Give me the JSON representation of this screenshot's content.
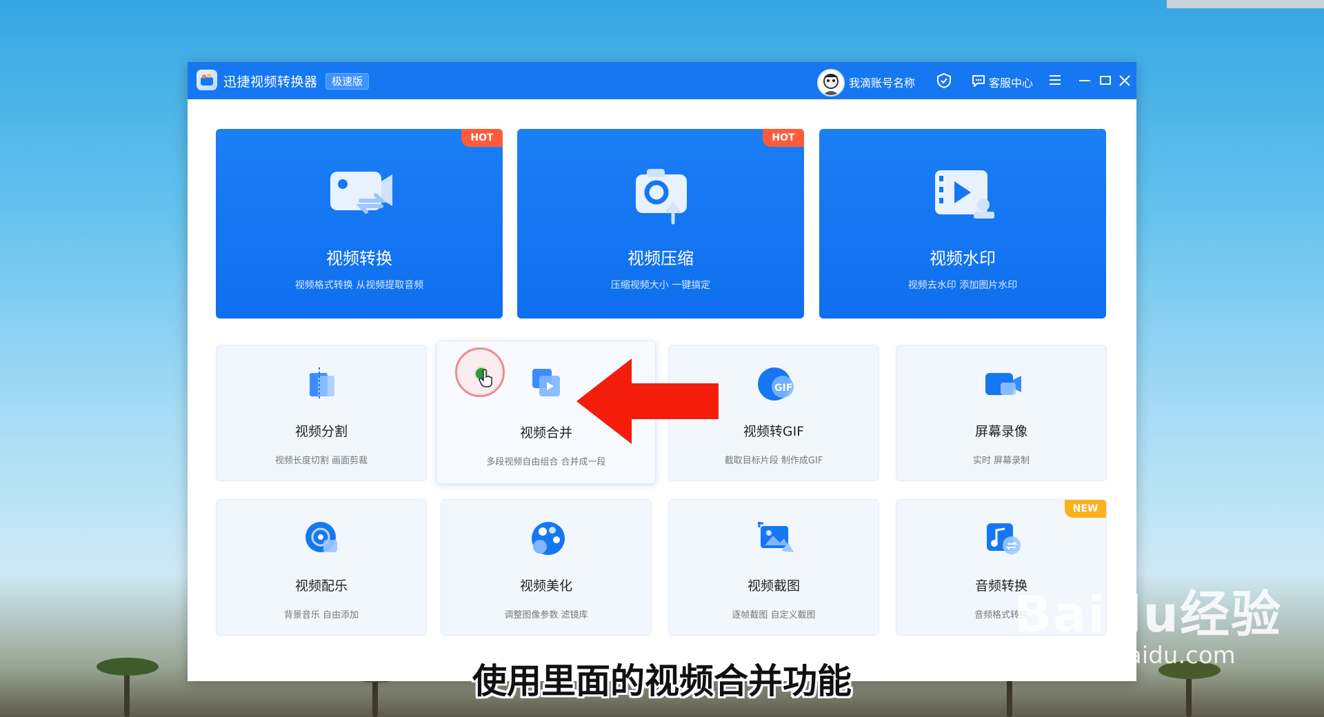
{
  "app": {
    "title": "迅捷视频转换器",
    "edition": "极速版",
    "account_name": "我滴账号名称",
    "service_label": "客服中心"
  },
  "feature_cards": [
    {
      "title": "视频转换",
      "desc": "视频格式转换 从视频提取音频",
      "badge": "HOT",
      "icon": "video-convert-icon"
    },
    {
      "title": "视频压缩",
      "desc": "压缩视频大小 一键搞定",
      "badge": "HOT",
      "icon": "video-compress-icon"
    },
    {
      "title": "视频水印",
      "desc": "视频去水印 添加图片水印",
      "badge": "",
      "icon": "video-watermark-icon"
    }
  ],
  "tool_cards": [
    {
      "title": "视频分割",
      "desc": "视频长度切割 画面剪裁",
      "icon": "video-split-icon"
    },
    {
      "title": "视频合并",
      "desc": "多段视频自由组合 合并成一段",
      "icon": "video-merge-icon"
    },
    {
      "title": "视频转GIF",
      "desc": "截取目标片段 制作成GIF",
      "icon": "video-gif-icon",
      "icon_text": "GIF"
    },
    {
      "title": "屏幕录像",
      "desc": "实时 屏幕录制",
      "icon": "screen-record-icon"
    },
    {
      "title": "视频配乐",
      "desc": "背景音乐 自由添加",
      "icon": "video-music-icon"
    },
    {
      "title": "视频美化",
      "desc": "调整图像参数 滤镜库",
      "icon": "video-beautify-icon"
    },
    {
      "title": "视频截图",
      "desc": "逐帧截图 自定义截图",
      "icon": "video-screenshot-icon"
    },
    {
      "title": "音频转换",
      "desc": "音频格式转换",
      "badge": "NEW",
      "icon": "audio-convert-icon"
    }
  ],
  "caption": "使用里面的视频合并功能",
  "watermark": {
    "main": "Baidu经验",
    "sub": "jingyan.baidu.com"
  },
  "colors": {
    "titlebar": "#1677f2",
    "card_blue": "#1677f2",
    "hot": "#ff5b3a",
    "new": "#ffb01f",
    "arrow": "#f41d0b"
  }
}
